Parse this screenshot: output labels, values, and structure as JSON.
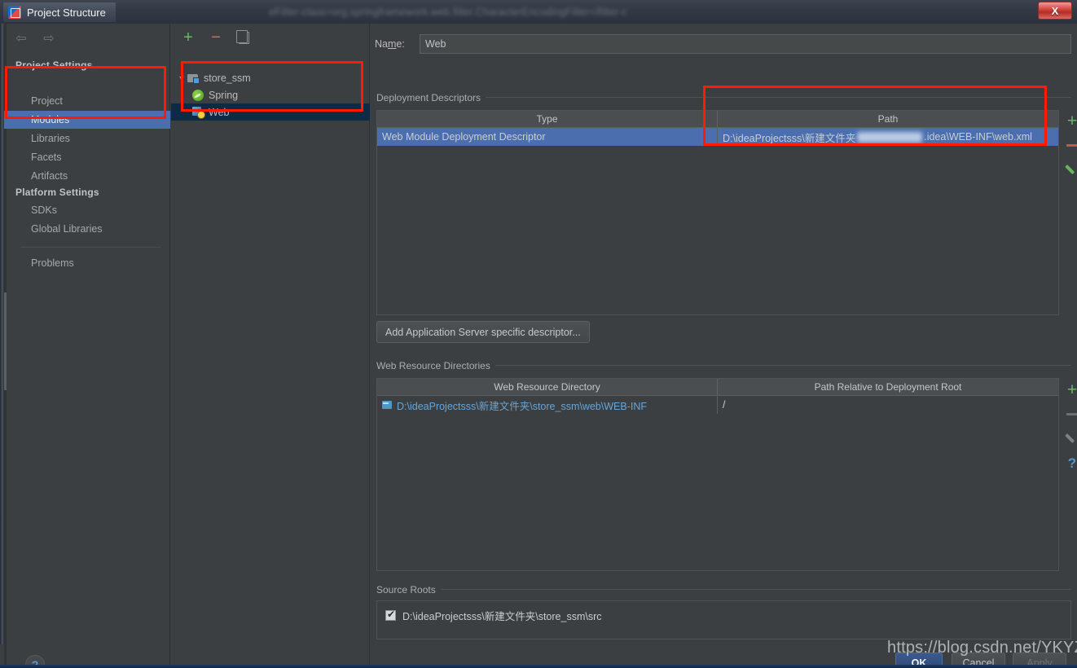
{
  "window": {
    "title": "Project Structure",
    "background_title_blurred": "eFilter-class=org.springframework.web.filter.CharacterEncodingFilter</filter-c",
    "close_label": "X"
  },
  "sidebar": {
    "back_icon": "⇦",
    "forward_icon": "⇨",
    "groups": [
      {
        "header": "Project Settings",
        "items": [
          {
            "label": "Project",
            "selected": false
          },
          {
            "label": "Modules",
            "selected": true
          },
          {
            "label": "Libraries",
            "selected": false
          },
          {
            "label": "Facets",
            "selected": false
          },
          {
            "label": "Artifacts",
            "selected": false
          }
        ]
      },
      {
        "header": "Platform Settings",
        "items": [
          {
            "label": "SDKs",
            "selected": false
          },
          {
            "label": "Global Libraries",
            "selected": false
          }
        ]
      }
    ],
    "problems_label": "Problems",
    "help_label": "?"
  },
  "tree": {
    "toolbar": {
      "add": "+",
      "remove": "−",
      "copy": "copy"
    },
    "nodes": [
      {
        "label": "store_ssm",
        "icon": "folder-module",
        "level": 0,
        "expanded": true,
        "selected": false
      },
      {
        "label": "Spring",
        "icon": "spring",
        "level": 1,
        "expanded": false,
        "selected": false
      },
      {
        "label": "Web",
        "icon": "web",
        "level": 1,
        "expanded": false,
        "selected": true
      }
    ]
  },
  "main": {
    "name_label_pre": "Na",
    "name_label_mnemonic": "m",
    "name_label_post": "e:",
    "name_value": "Web",
    "deployment": {
      "section_title": "Deployment Descriptors",
      "columns": [
        "Type",
        "Path"
      ],
      "rows": [
        {
          "type": "Web Module Deployment Descriptor",
          "path_prefix": "D:\\ideaProjectsss\\新建文件夹",
          "path_redacted": true,
          "path_suffix": ".idea\\WEB-INF\\web.xml",
          "selected": true
        }
      ],
      "actions": [
        "add",
        "remove",
        "edit"
      ]
    },
    "add_descriptor_button": "Add Application Server specific descriptor...",
    "web_resources": {
      "section_title": "Web Resource Directories",
      "columns": [
        "Web Resource Directory",
        "Path Relative to Deployment Root"
      ],
      "rows": [
        {
          "directory": "D:\\ideaProjectsss\\新建文件夹\\store_ssm\\web\\WEB-INF",
          "relative_path": "/"
        }
      ],
      "actions": [
        "add",
        "remove",
        "edit",
        "help"
      ]
    },
    "source_roots": {
      "section_title": "Source Roots",
      "rows": [
        {
          "path": "D:\\ideaProjectsss\\新建文件夹\\store_ssm\\src",
          "checked": true
        }
      ]
    }
  },
  "footer": {
    "ok": "OK",
    "cancel": "Cancel",
    "apply": "Apply",
    "apply_enabled": false
  },
  "watermark": "https://blog.csdn.net/YKYZSYA",
  "colors": {
    "accent_selection": "#4b6eaf",
    "tree_selection": "#0d2b45",
    "annotation_red": "#ff1a00",
    "link_cyan": "#68a5d6",
    "panel_bg": "#3c3f41"
  }
}
